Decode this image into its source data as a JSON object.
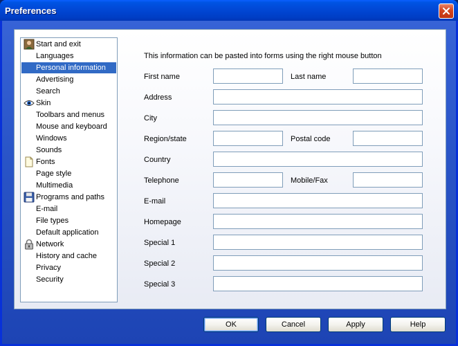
{
  "window": {
    "title": "Preferences"
  },
  "sidebar": {
    "items": [
      {
        "label": "Start and exit",
        "icon": "person-icon"
      },
      {
        "label": "Languages",
        "icon": ""
      },
      {
        "label": "Personal information",
        "icon": "",
        "selected": true
      },
      {
        "label": "Advertising",
        "icon": ""
      },
      {
        "label": "Search",
        "icon": ""
      },
      {
        "label": "Skin",
        "icon": "eye-icon"
      },
      {
        "label": "Toolbars and menus",
        "icon": ""
      },
      {
        "label": "Mouse and keyboard",
        "icon": ""
      },
      {
        "label": "Windows",
        "icon": ""
      },
      {
        "label": "Sounds",
        "icon": ""
      },
      {
        "label": "Fonts",
        "icon": "page-icon"
      },
      {
        "label": "Page style",
        "icon": ""
      },
      {
        "label": "Multimedia",
        "icon": ""
      },
      {
        "label": "Programs and paths",
        "icon": "floppy-disk-icon"
      },
      {
        "label": "E-mail",
        "icon": ""
      },
      {
        "label": "File types",
        "icon": ""
      },
      {
        "label": "Default application",
        "icon": ""
      },
      {
        "label": "Network",
        "icon": "padlock-icon"
      },
      {
        "label": "History and cache",
        "icon": ""
      },
      {
        "label": "Privacy",
        "icon": ""
      },
      {
        "label": "Security",
        "icon": ""
      }
    ]
  },
  "form": {
    "intro": "This information can be pasted into forms using the right mouse button",
    "first_name": {
      "label": "First name",
      "value": ""
    },
    "last_name": {
      "label": "Last name",
      "value": ""
    },
    "address": {
      "label": "Address",
      "value": ""
    },
    "city": {
      "label": "City",
      "value": ""
    },
    "region": {
      "label": "Region/state",
      "value": ""
    },
    "postal_code": {
      "label": "Postal code",
      "value": ""
    },
    "country": {
      "label": "Country",
      "value": ""
    },
    "telephone": {
      "label": "Telephone",
      "value": ""
    },
    "mobile": {
      "label": "Mobile/Fax",
      "value": ""
    },
    "email": {
      "label": "E-mail",
      "value": ""
    },
    "homepage": {
      "label": "Homepage",
      "value": ""
    },
    "special1": {
      "label": "Special 1",
      "value": ""
    },
    "special2": {
      "label": "Special 2",
      "value": ""
    },
    "special3": {
      "label": "Special 3",
      "value": ""
    }
  },
  "buttons": {
    "ok": "OK",
    "cancel": "Cancel",
    "apply": "Apply",
    "help": "Help"
  },
  "colors": {
    "selection": "#316ac5",
    "titlebar": "#0054e3",
    "close": "#d3441f"
  }
}
